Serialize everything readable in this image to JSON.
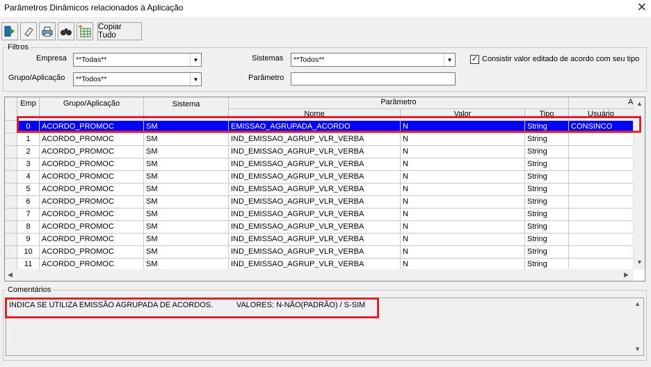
{
  "window": {
    "title": "Parâmetros Dinâmicos relacionados à Aplicação",
    "close_glyph": "✕"
  },
  "toolbar": {
    "copy_all_label": "Copiar Tudo",
    "icons": [
      "exit-icon",
      "eraser-icon",
      "print-icon",
      "binoculars-icon",
      "grid-calc-icon"
    ]
  },
  "filters": {
    "legend": "Filtros",
    "empresa_label": "Empresa",
    "empresa_value": "**Todas**",
    "grupo_label": "Grupo/Aplicação",
    "grupo_value": "**Todos**",
    "sistemas_label": "Sistemas",
    "sistemas_value": "**Todos**",
    "parametro_label": "Parâmetro",
    "parametro_value": "",
    "consistir_label": "Consistir valor editado de acordo com seu tipo",
    "consistir_checked": "✓"
  },
  "grid": {
    "headers": {
      "emp": "Emp",
      "grupo": "Grupo/Aplicação",
      "sistema": "Sistema",
      "parametro": "Parâmetro",
      "nome": "Nome",
      "valor": "Valor",
      "tipo": "Tipo",
      "alteracao": "Alte",
      "usuario": "Usuário"
    },
    "rows": [
      {
        "emp": "0",
        "grupo": "ACORDO_PROMOC",
        "sistema": "SM",
        "nome": "EMISSAO_AGRUPADA_ACORDO",
        "valor": "N",
        "tipo": "String",
        "usuario": "CONSINCO"
      },
      {
        "emp": "1",
        "grupo": "ACORDO_PROMOC",
        "sistema": "SM",
        "nome": "IND_EMISSAO_AGRUP_VLR_VERBA",
        "valor": "N",
        "tipo": "String",
        "usuario": ""
      },
      {
        "emp": "2",
        "grupo": "ACORDO_PROMOC",
        "sistema": "SM",
        "nome": "IND_EMISSAO_AGRUP_VLR_VERBA",
        "valor": "N",
        "tipo": "String",
        "usuario": ""
      },
      {
        "emp": "3",
        "grupo": "ACORDO_PROMOC",
        "sistema": "SM",
        "nome": "IND_EMISSAO_AGRUP_VLR_VERBA",
        "valor": "N",
        "tipo": "String",
        "usuario": ""
      },
      {
        "emp": "4",
        "grupo": "ACORDO_PROMOC",
        "sistema": "SM",
        "nome": "IND_EMISSAO_AGRUP_VLR_VERBA",
        "valor": "N",
        "tipo": "String",
        "usuario": ""
      },
      {
        "emp": "5",
        "grupo": "ACORDO_PROMOC",
        "sistema": "SM",
        "nome": "IND_EMISSAO_AGRUP_VLR_VERBA",
        "valor": "N",
        "tipo": "String",
        "usuario": ""
      },
      {
        "emp": "6",
        "grupo": "ACORDO_PROMOC",
        "sistema": "SM",
        "nome": "IND_EMISSAO_AGRUP_VLR_VERBA",
        "valor": "N",
        "tipo": "String",
        "usuario": ""
      },
      {
        "emp": "7",
        "grupo": "ACORDO_PROMOC",
        "sistema": "SM",
        "nome": "IND_EMISSAO_AGRUP_VLR_VERBA",
        "valor": "N",
        "tipo": "String",
        "usuario": ""
      },
      {
        "emp": "8",
        "grupo": "ACORDO_PROMOC",
        "sistema": "SM",
        "nome": "IND_EMISSAO_AGRUP_VLR_VERBA",
        "valor": "N",
        "tipo": "String",
        "usuario": ""
      },
      {
        "emp": "9",
        "grupo": "ACORDO_PROMOC",
        "sistema": "SM",
        "nome": "IND_EMISSAO_AGRUP_VLR_VERBA",
        "valor": "N",
        "tipo": "String",
        "usuario": ""
      },
      {
        "emp": "10",
        "grupo": "ACORDO_PROMOC",
        "sistema": "SM",
        "nome": "IND_EMISSAO_AGRUP_VLR_VERBA",
        "valor": "N",
        "tipo": "String",
        "usuario": ""
      },
      {
        "emp": "11",
        "grupo": "ACORDO_PROMOC",
        "sistema": "SM",
        "nome": "IND_EMISSAO_AGRUP_VLR_VERBA",
        "valor": "N",
        "tipo": "String",
        "usuario": ""
      }
    ],
    "selected_row": 0
  },
  "comments": {
    "legend": "Comentários",
    "text": "INDICA SE UTILIZA EMISSÃO AGRUPADA DE ACORDOS.           VALORES: N-NÃO(PADRÃO) / S-SIM"
  },
  "colors": {
    "selection": "#0000ff",
    "highlight_box": "#e0202a"
  }
}
